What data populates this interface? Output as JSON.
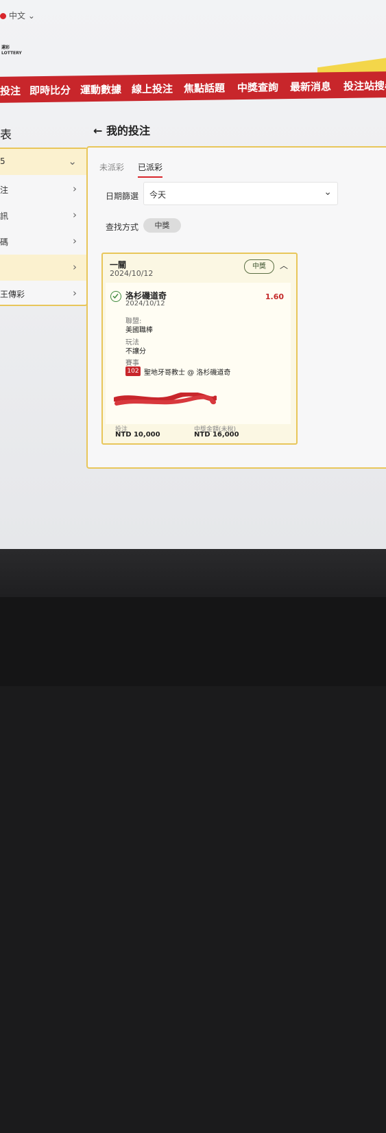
{
  "header": {
    "language": "中文 ⌄",
    "logo_text": "運彩",
    "logo_sub": "LOTTERY"
  },
  "nav": [
    "投注",
    "即時比分",
    "運動數據",
    "線上投注",
    "焦點話題",
    "中獎查詢",
    "最新消息",
    "投注站搜尋"
  ],
  "sidebar": {
    "title": "表",
    "items": [
      {
        "label": "5"
      },
      {
        "label": "注"
      },
      {
        "label": "訊"
      },
      {
        "label": "碼"
      },
      {
        "label": ""
      },
      {
        "label": "王傳彩"
      }
    ]
  },
  "page": {
    "title": "我的投注",
    "tabs": [
      "未派彩",
      "已派彩"
    ],
    "date_filter_label": "日期篩選",
    "date_filter_value": "今天",
    "search_label": "查找方式",
    "search_chip": "中獎"
  },
  "bet": {
    "type": "一關",
    "date": "2024/10/12",
    "status": "中獎",
    "team": "洛杉磯道奇",
    "team_date": "2024/10/12",
    "odds": "1.60",
    "league_label": "聯盟:",
    "league": "美國職棒",
    "play_label": "玩法",
    "play": "不讓分",
    "event_label": "賽事",
    "game_no": "102",
    "match": "聖地牙哥教士 @ 洛杉磯道奇",
    "stake_label": "投注",
    "stake": "NTD 10,000",
    "payout_label": "中獎金額(未稅)",
    "payout": "NTD 16,000"
  },
  "colors": {
    "brand_red": "#c8262b",
    "gold_border": "#e8c65a",
    "odds_red": "#c42a2a"
  }
}
